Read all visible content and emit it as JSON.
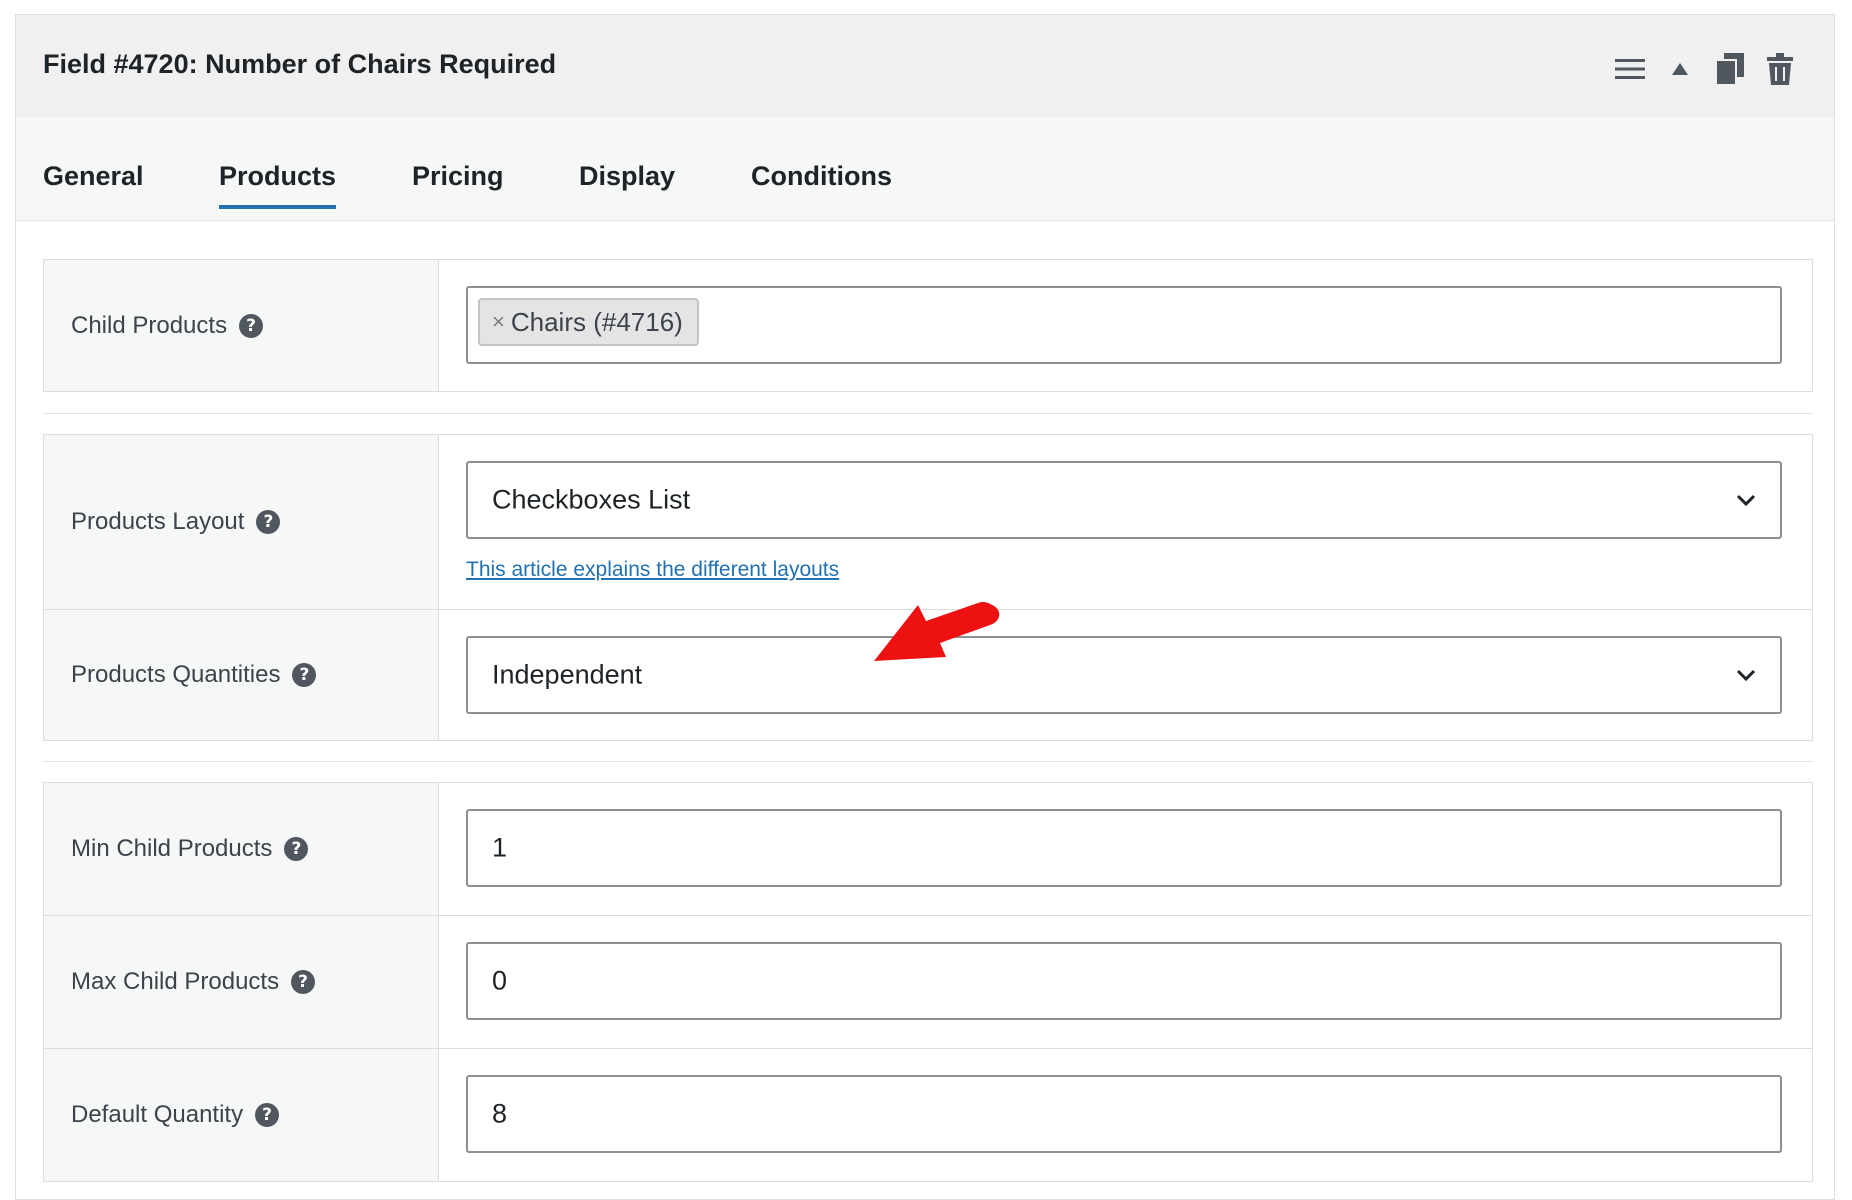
{
  "header": {
    "title": "Field #4720: Number of Chairs Required",
    "actions": [
      "menu-icon",
      "collapse-icon",
      "duplicate-icon",
      "trash-icon"
    ]
  },
  "tabs": [
    {
      "label": "General",
      "active": false
    },
    {
      "label": "Products",
      "active": true
    },
    {
      "label": "Pricing",
      "active": false
    },
    {
      "label": "Display",
      "active": false
    },
    {
      "label": "Conditions",
      "active": false
    }
  ],
  "child_products": {
    "label": "Child Products",
    "help": "?",
    "tokens": [
      {
        "remove": "×",
        "text": "Chairs (#4716)"
      }
    ]
  },
  "products_layout": {
    "label": "Products Layout",
    "help": "?",
    "value": "Checkboxes List",
    "link": "This article explains the different layouts"
  },
  "products_quantities": {
    "label": "Products Quantities",
    "help": "?",
    "value": "Independent"
  },
  "min_child": {
    "label": "Min Child Products",
    "help": "?",
    "value": "1"
  },
  "max_child": {
    "label": "Max Child Products",
    "help": "?",
    "value": "0"
  },
  "default_qty": {
    "label": "Default Quantity",
    "help": "?",
    "value": "8"
  },
  "colors": {
    "accent": "#2271b1",
    "annotation_arrow": "#ee1111"
  }
}
